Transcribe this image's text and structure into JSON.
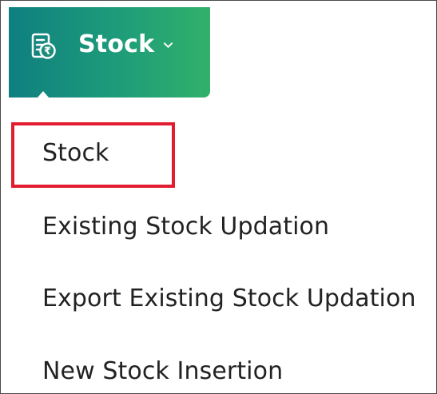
{
  "nav": {
    "label": "Stock",
    "icon": "stock-rupee-icon",
    "chevron_icon": "chevron-down-icon",
    "background_start": "#0f7f80",
    "background_end": "#31b06b"
  },
  "menu": {
    "items": [
      {
        "label": "Stock",
        "highlighted": true
      },
      {
        "label": "Existing Stock Updation",
        "highlighted": false
      },
      {
        "label": "Export Existing Stock Updation",
        "highlighted": false
      },
      {
        "label": "New Stock Insertion",
        "highlighted": false
      }
    ]
  },
  "colors": {
    "highlight": "#e11d2f",
    "text": "#222222"
  }
}
